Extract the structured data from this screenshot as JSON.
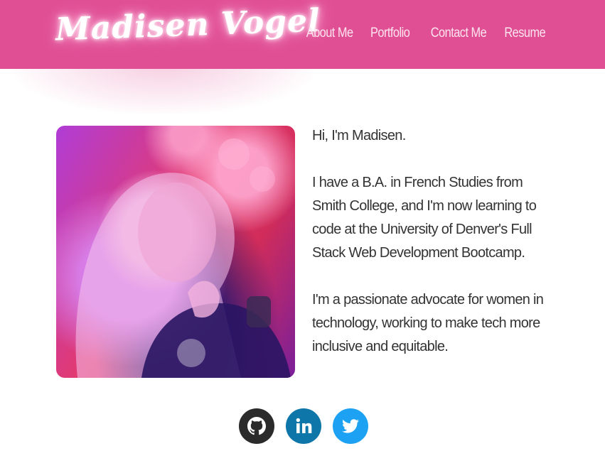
{
  "header": {
    "brand": "Madisen Vogel",
    "nav": [
      "About Me",
      "Portfolio",
      "Contact Me",
      "Resume"
    ]
  },
  "main": {
    "photo_icon": "portrait-photo",
    "bio": [
      "Hi, I'm Madisen.",
      "I have a B.A. in French Studies from Smith College, and I'm now learning to code at the University of Denver's Full Stack Web Development Bootcamp.",
      "I'm a passionate advocate for women in technology, working to make tech more inclusive and equitable."
    ]
  },
  "social": [
    {
      "name": "github",
      "icon": "github-icon",
      "color": "#2b2b2b"
    },
    {
      "name": "linkedin",
      "icon": "linkedin-icon",
      "color": "#0e76a8"
    },
    {
      "name": "twitter",
      "icon": "twitter-icon",
      "color": "#1da1f2"
    }
  ],
  "colors": {
    "navbar": "#e04f94",
    "nav_text": "#fde4ef",
    "body_text": "#333333"
  }
}
